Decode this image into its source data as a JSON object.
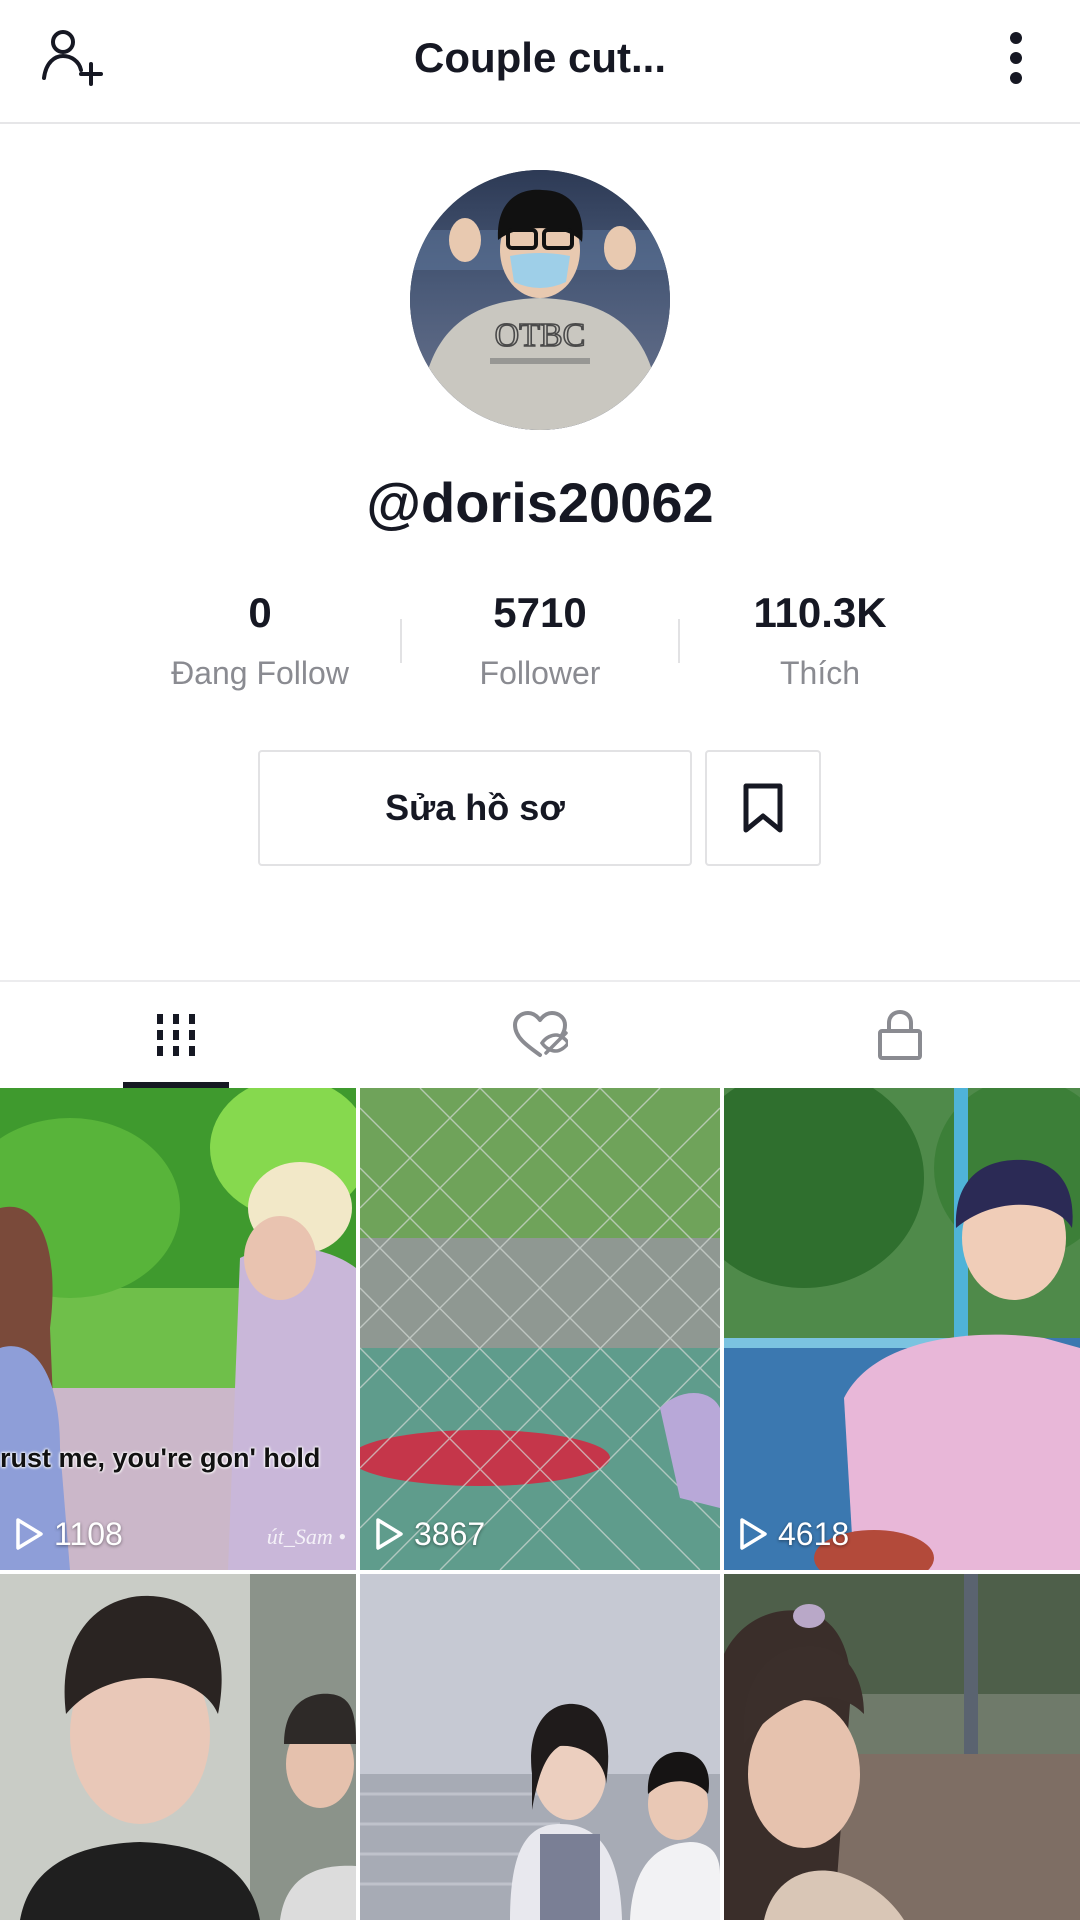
{
  "header": {
    "title": "Couple cut...",
    "add_friend_icon": "person-add-icon",
    "menu_icon": "vertical-dots-icon"
  },
  "profile": {
    "username": "@doris20062",
    "avatar_shirt_text": "OTBC"
  },
  "stats": [
    {
      "value": "0",
      "label": "Đang Follow"
    },
    {
      "value": "5710",
      "label": "Follower"
    },
    {
      "value": "110.3K",
      "label": "Thích"
    }
  ],
  "actions": {
    "edit_profile_label": "Sửa hồ sơ",
    "bookmark_icon": "bookmark-icon"
  },
  "tabs": [
    {
      "name": "videos",
      "icon": "grid-bars-icon",
      "active": true
    },
    {
      "name": "liked",
      "icon": "hidden-heart-icon",
      "active": false
    },
    {
      "name": "private",
      "icon": "lock-icon",
      "active": false
    }
  ],
  "videos": [
    {
      "views": "1108",
      "caption": "rust me, you're gon' hold",
      "watermark": "út_Sam •"
    },
    {
      "views": "3867"
    },
    {
      "views": "4618"
    },
    {},
    {},
    {}
  ],
  "colors": {
    "text_primary": "#161823",
    "text_secondary": "#8a8b91",
    "divider": "#e2e2e4"
  }
}
